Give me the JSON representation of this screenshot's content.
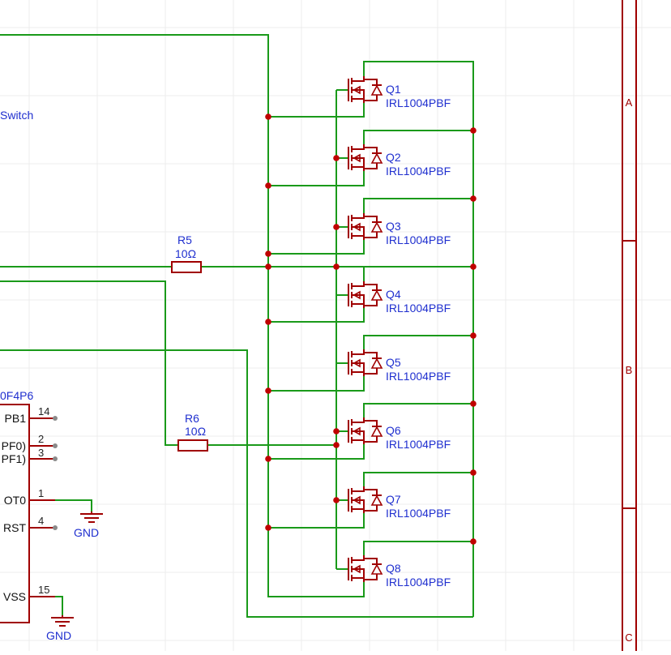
{
  "net_labels": {
    "switch_text": "Switch"
  },
  "mosfets": [
    {
      "ref": "Q1",
      "value": "IRL1004PBF"
    },
    {
      "ref": "Q2",
      "value": "IRL1004PBF"
    },
    {
      "ref": "Q3",
      "value": "IRL1004PBF"
    },
    {
      "ref": "Q4",
      "value": "IRL1004PBF"
    },
    {
      "ref": "Q5",
      "value": "IRL1004PBF"
    },
    {
      "ref": "Q6",
      "value": "IRL1004PBF"
    },
    {
      "ref": "Q7",
      "value": "IRL1004PBF"
    },
    {
      "ref": "Q8",
      "value": "IRL1004PBF"
    }
  ],
  "resistors": [
    {
      "ref": "R5",
      "value": "10Ω"
    },
    {
      "ref": "R6",
      "value": "10Ω"
    }
  ],
  "mcu": {
    "part_fragment": "0F4P6",
    "pins": [
      {
        "name": "PB1",
        "number": "14"
      },
      {
        "name": "PF0)",
        "number": "2"
      },
      {
        "name": "PF1)",
        "number": "3"
      },
      {
        "name": "OT0",
        "number": "1"
      },
      {
        "name": "RST",
        "number": "4"
      },
      {
        "name": "VSS",
        "number": "15"
      }
    ]
  },
  "gnd_labels": [
    "GND",
    "GND"
  ],
  "border_zones": [
    "A",
    "B",
    "C"
  ],
  "colors": {
    "wire": "#1a9a1a",
    "component": "#a00000",
    "label": "#1f2fcf",
    "junction": "#c00000",
    "grid": "#ececec"
  }
}
